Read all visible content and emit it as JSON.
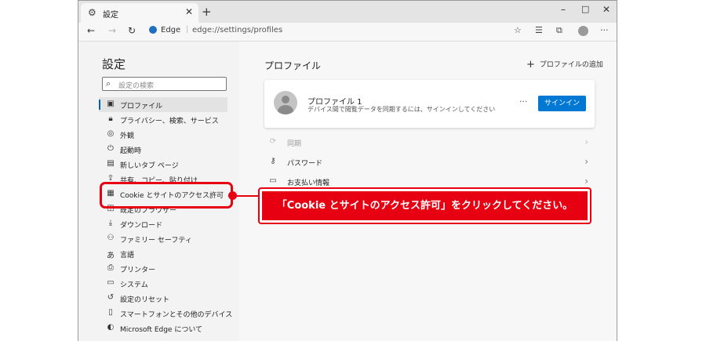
{
  "tab": {
    "title": "設定",
    "icon": "gear-icon"
  },
  "window_controls": {
    "minimize": "–",
    "maximize": "□",
    "close": "✕"
  },
  "addressbar": {
    "browser_label": "Edge",
    "url": "edge://settings/profiles"
  },
  "sidebar": {
    "title": "設定",
    "search_placeholder": "設定の検索",
    "items": [
      {
        "label": "プロファイル",
        "icon": "profile-icon",
        "selected": true
      },
      {
        "label": "プライバシー、検索、サービス",
        "icon": "lock-icon"
      },
      {
        "label": "外観",
        "icon": "palette-icon"
      },
      {
        "label": "起動時",
        "icon": "power-icon"
      },
      {
        "label": "新しいタブ ページ",
        "icon": "newtab-icon"
      },
      {
        "label": "共有、コピー、貼り付け",
        "icon": "share-icon"
      },
      {
        "label": "Cookie とサイトのアクセス許可",
        "icon": "cookie-icon"
      },
      {
        "label": "既定のブラウザー",
        "icon": "browser-icon"
      },
      {
        "label": "ダウンロード",
        "icon": "download-icon"
      },
      {
        "label": "ファミリー セーフティ",
        "icon": "family-icon"
      },
      {
        "label": "言語",
        "icon": "language-icon"
      },
      {
        "label": "プリンター",
        "icon": "printer-icon"
      },
      {
        "label": "システム",
        "icon": "system-icon"
      },
      {
        "label": "設定のリセット",
        "icon": "reset-icon"
      },
      {
        "label": "スマートフォンとその他のデバイス",
        "icon": "phone-icon"
      },
      {
        "label": "Microsoft Edge について",
        "icon": "edge-icon"
      }
    ]
  },
  "main": {
    "title": "プロファイル",
    "add_profile": "プロファイルの追加",
    "profile": {
      "name": "プロファイル 1",
      "description": "デバイス間で閲覧データを同期するには、サインインしてください",
      "more": "···",
      "signin": "サインイン"
    },
    "rows": [
      {
        "label": "同期",
        "icon": "sync-icon",
        "disabled": true
      },
      {
        "label": "パスワード",
        "icon": "key-icon"
      },
      {
        "label": "お支払い情報",
        "icon": "card-icon"
      }
    ]
  },
  "callout": {
    "text": "「Cookie とサイトのアクセス許可」をクリックしてください。"
  },
  "colors": {
    "accent": "#0078d4",
    "highlight": "#e60012"
  }
}
